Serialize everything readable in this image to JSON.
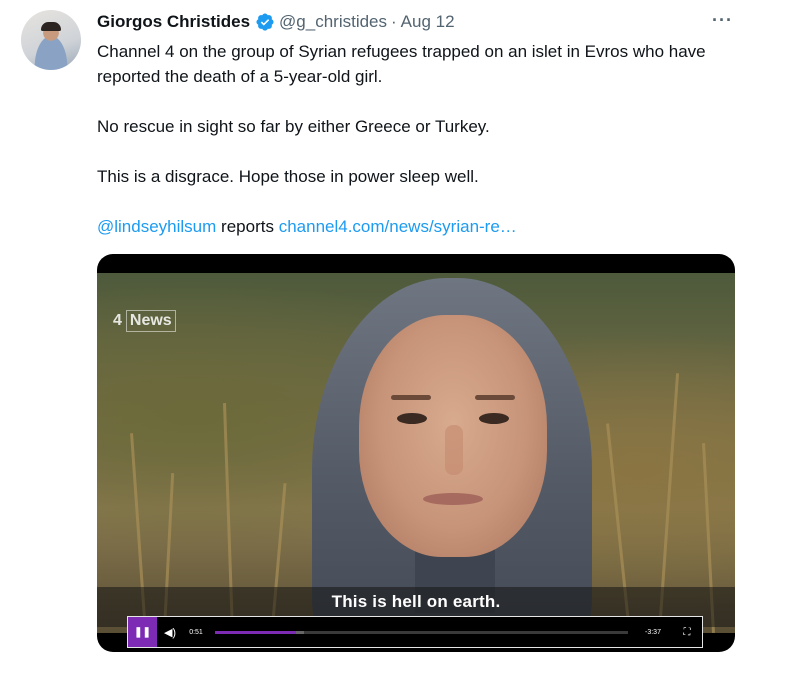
{
  "tweet": {
    "author_name": "Giorgos Christides",
    "handle": "@g_christides",
    "separator": "·",
    "date": "Aug 12",
    "more_label": "···",
    "paragraphs": [
      "Channel 4 on the group of Syrian refugees trapped on an islet in Evros who have reported the death of a 5-year-old girl.",
      "No rescue in sight so far by either Greece or Turkey.",
      "This is a disgrace. Hope those in power sleep well."
    ],
    "mention": "@lindseyhilsum",
    "reports_word": "reports",
    "url_text": "channel4.com/news/syrian-re…"
  },
  "video": {
    "watermark_glyph": "4",
    "watermark_label": "News",
    "subtitle": "This is hell on earth.",
    "elapsed": "0:51",
    "remaining": "-3:37",
    "progress_fraction": 0.195,
    "buffered_fraction": 0.215,
    "play_state_icon": "pause-icon"
  },
  "colors": {
    "link": "#1d9bf0",
    "verified": "#1d9bf0",
    "player_accent": "#7d2bb5"
  }
}
